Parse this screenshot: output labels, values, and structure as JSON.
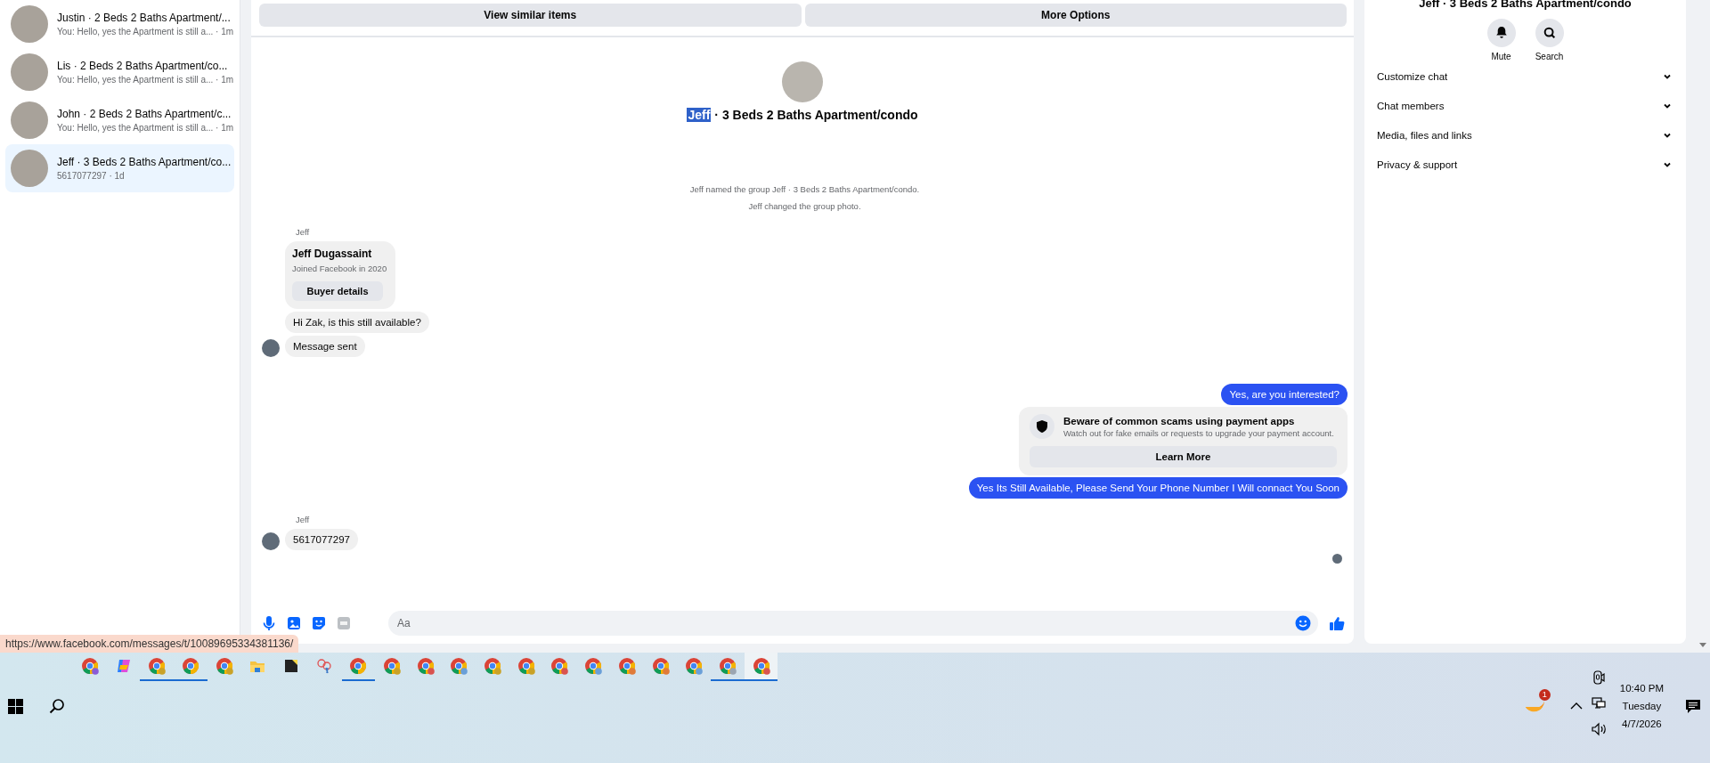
{
  "conversations": [
    {
      "title": "Justin · 2 Beds 2 Baths Apartment/...",
      "preview": "You: Hello, yes the Apartment is still a... · 1m",
      "selected": false
    },
    {
      "title": "Lis · 2 Beds 2 Baths Apartment/co...",
      "preview": "You: Hello, yes the Apartment is still a... · 1m",
      "selected": false
    },
    {
      "title": "John · 2 Beds 2 Baths Apartment/c...",
      "preview": "You: Hello, yes the Apartment is still a... · 1m",
      "selected": false
    },
    {
      "title": "Jeff · 3 Beds 2 Baths Apartment/co...",
      "preview": "5617077297 · 1d",
      "selected": true
    }
  ],
  "status_url": "https://www.facebook.com/messages/t/10089695334381136/",
  "chat": {
    "actions": [
      "View similar items",
      "More Options"
    ],
    "header": {
      "name": "Jeff",
      "name_highlighted": true,
      "title_rest": "· 3 Beds 2 Baths Apartment/condo"
    },
    "messages": [
      {
        "kind": "system",
        "text": "Jeff named the group Jeff · 3 Beds 2 Baths Apartment/condo."
      },
      {
        "kind": "system",
        "text": "Jeff changed the group photo."
      },
      {
        "kind": "sender",
        "text": "Jeff"
      },
      {
        "kind": "profile_card",
        "name": "Jeff Dugassaint",
        "subtitle": "Joined Facebook in 2020",
        "button": "Buyer details"
      },
      {
        "kind": "incoming",
        "text": "Hi Zak, is this still available?",
        "avatar": false
      },
      {
        "kind": "incoming",
        "text": "Message sent",
        "avatar": true
      },
      {
        "kind": "outgoing",
        "text": "Yes, are you interested?"
      },
      {
        "kind": "warning",
        "title": "Beware of common scams using payment apps",
        "text": "Watch out for fake emails or requests to upgrade your payment account.",
        "button": "Learn More"
      },
      {
        "kind": "outgoing",
        "text": "Yes Its Still Available, Please Send Your Phone Number I Will connact You Soon"
      },
      {
        "kind": "sender",
        "text": "Jeff"
      },
      {
        "kind": "incoming",
        "text": "5617077297",
        "avatar": true
      },
      {
        "kind": "seen"
      }
    ],
    "composer": {
      "placeholder": "Aa"
    }
  },
  "details": {
    "title": "Jeff · 3 Beds 2 Baths Apartment/condo",
    "actions": [
      {
        "label": "Mute",
        "kind": "bell"
      },
      {
        "label": "Search",
        "kind": "search"
      }
    ],
    "sections": [
      {
        "label": "Customize chat",
        "expanded": false
      },
      {
        "label": "Chat members",
        "expanded": false
      },
      {
        "label": "Media, files and links",
        "expanded": false
      },
      {
        "label": "Privacy & support",
        "expanded": false
      }
    ]
  },
  "taskbar": {
    "apps": [
      {
        "kind": "chrome",
        "running": false,
        "selected": false,
        "color": "#8a5cd6"
      },
      {
        "kind": "copilot",
        "running": false,
        "selected": false
      },
      {
        "kind": "chrome",
        "running": true,
        "selected": false,
        "color": "#c9a227"
      },
      {
        "kind": "chrome",
        "running": true,
        "selected": false
      },
      {
        "kind": "chrome",
        "running": false,
        "selected": false,
        "color": "#c9a227"
      },
      {
        "kind": "folder",
        "running": false,
        "selected": false
      },
      {
        "kind": "notes",
        "running": false,
        "selected": false
      },
      {
        "kind": "snip",
        "running": false,
        "selected": false
      },
      {
        "kind": "chrome",
        "running": true,
        "selected": false
      },
      {
        "kind": "chrome",
        "running": false,
        "selected": false,
        "color": "#c9a227"
      },
      {
        "kind": "chrome",
        "running": false,
        "selected": false,
        "color": "#d9534f"
      },
      {
        "kind": "chrome",
        "running": false,
        "selected": false,
        "color": "#6a9fd8"
      },
      {
        "kind": "chrome",
        "running": false,
        "selected": false,
        "color": "#c9a227"
      },
      {
        "kind": "chrome",
        "running": false,
        "selected": false,
        "color": "#c9a227"
      },
      {
        "kind": "chrome",
        "running": false,
        "selected": false,
        "color": "#d9534f"
      },
      {
        "kind": "chrome",
        "running": false,
        "selected": false,
        "color": "#6a9fd8"
      },
      {
        "kind": "chrome",
        "running": false,
        "selected": false,
        "color": "#e07b39"
      },
      {
        "kind": "chrome",
        "running": false,
        "selected": false,
        "color": "#e07b39"
      },
      {
        "kind": "chrome",
        "running": false,
        "selected": false,
        "color": "#6a9fd8"
      },
      {
        "kind": "chrome",
        "running": true,
        "selected": false,
        "color": "#9aa5b1"
      },
      {
        "kind": "chrome",
        "running": true,
        "selected": true,
        "color": "#d9534f"
      }
    ],
    "notification_count": "1",
    "clock": {
      "time": "10:40 PM",
      "day": "Tuesday",
      "date": "4/7/2026"
    }
  }
}
